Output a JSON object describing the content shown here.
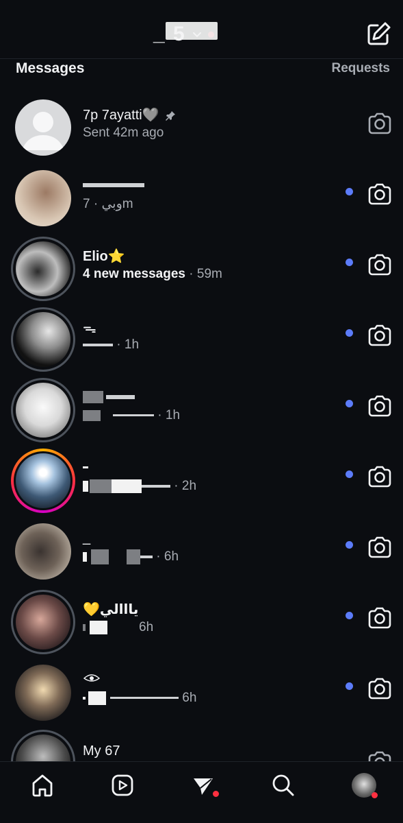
{
  "header": {
    "account_name": "_ 5",
    "compose_icon": "compose-icon",
    "chevron_icon": "chevron-down-icon"
  },
  "section": {
    "title": "Messages",
    "requests_label": "Requests"
  },
  "chats": [
    {
      "name": "7p 7ayatti🩶",
      "subtitle": "Sent 42m ago",
      "unread": false,
      "pinned": true
    },
    {
      "name": "",
      "subtitle": "وبي · 7m",
      "unread": true
    },
    {
      "name": "Elio⭐",
      "subtitle_bold": "4 new messages",
      "subtitle": "· 59m",
      "unread": true
    },
    {
      "name": "ᯓ",
      "subtitle": "· 1h",
      "unread": true
    },
    {
      "name": "",
      "subtitle": "· 1h",
      "unread": true
    },
    {
      "name": "",
      "subtitle": "· 2h",
      "unread": true
    },
    {
      "name": "_",
      "subtitle": "· 6h",
      "unread": true
    },
    {
      "name": "💛يااالي",
      "subtitle": "6h",
      "unread": true
    },
    {
      "name": "",
      "subtitle": "6h",
      "unread": true
    },
    {
      "name": "My 67",
      "subtitle": "",
      "unread": false
    }
  ],
  "colors": {
    "background": "#0b0d11",
    "unread_dot": "#5c7cfa",
    "notification_dot": "#ff3040"
  },
  "nav": [
    "home-icon",
    "reels-icon",
    "direct-icon",
    "search-icon",
    "profile-avatar"
  ]
}
